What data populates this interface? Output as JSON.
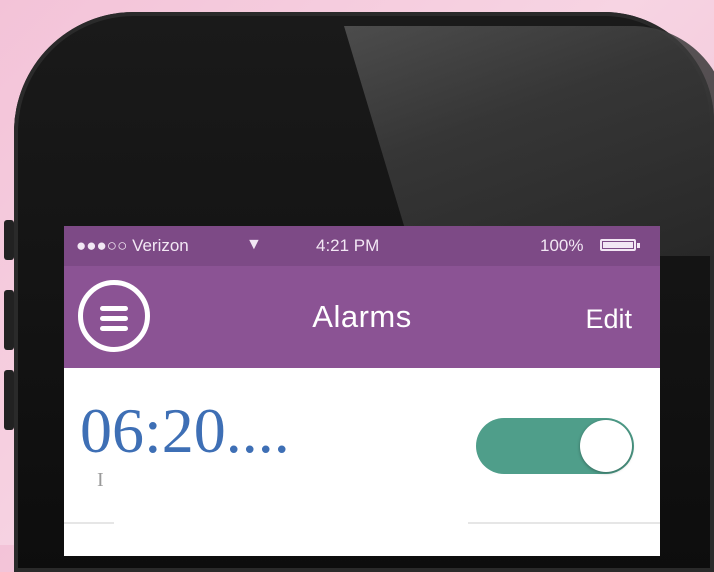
{
  "status_bar": {
    "carrier": "●●●○○ Verizon",
    "wifi_icon": "wifi-icon",
    "time": "4:21 PM",
    "battery_percent": "100%",
    "battery_level": 1.0
  },
  "nav": {
    "menu_icon": "hamburger-menu-icon",
    "title": "Alarms",
    "edit_label": "Edit"
  },
  "alarm": {
    "time": "06:20....",
    "subtitle": "I",
    "enabled": true
  },
  "colors": {
    "status_bar": "#7d4a86",
    "nav_bar": "#8b5394",
    "toggle_on": "#4f9e8a",
    "time_text": "#3e6fb5"
  }
}
